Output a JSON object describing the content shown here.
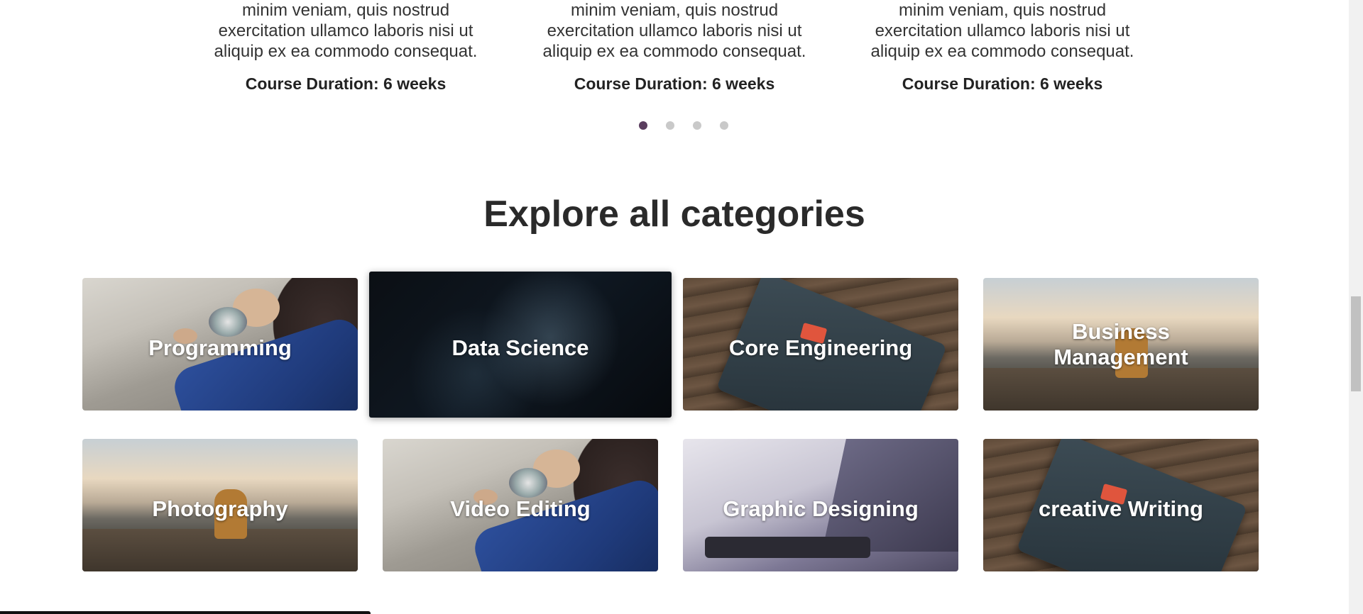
{
  "courses": [
    {
      "description": [
        "minim veniam, quis nostrud",
        "exercitation ullamco laboris nisi ut",
        "aliquip ex ea commodo consequat."
      ],
      "duration": "Course Duration: 6 weeks"
    },
    {
      "description": [
        "minim veniam, quis nostrud",
        "exercitation ullamco laboris nisi ut",
        "aliquip ex ea commodo consequat."
      ],
      "duration": "Course Duration: 6 weeks"
    },
    {
      "description": [
        "minim veniam, quis nostrud",
        "exercitation ullamco laboris nisi ut",
        "aliquip ex ea commodo consequat."
      ],
      "duration": "Course Duration: 6 weeks"
    }
  ],
  "carousel": {
    "dot_count": 4,
    "active_index": 0,
    "active_color": "#5a3d5e",
    "inactive_color": "#c9c9c9"
  },
  "categories_section": {
    "title": "Explore all categories",
    "items": [
      {
        "label": "Programming",
        "image": "watch-photo"
      },
      {
        "label": "Data Science",
        "image": "dark-tech-photo"
      },
      {
        "label": "Core Engineering",
        "image": "notebook-photo"
      },
      {
        "label": "Business Management",
        "label_lines": [
          "Business",
          "Management"
        ],
        "image": "mountain-photo"
      },
      {
        "label": "Photography",
        "image": "mountain-photo"
      },
      {
        "label": "Video Editing",
        "image": "watch-photo"
      },
      {
        "label": "Graphic Designing",
        "image": "laptop-drawing-photo"
      },
      {
        "label": "creative Writing",
        "image": "notebook-photo"
      }
    ]
  }
}
